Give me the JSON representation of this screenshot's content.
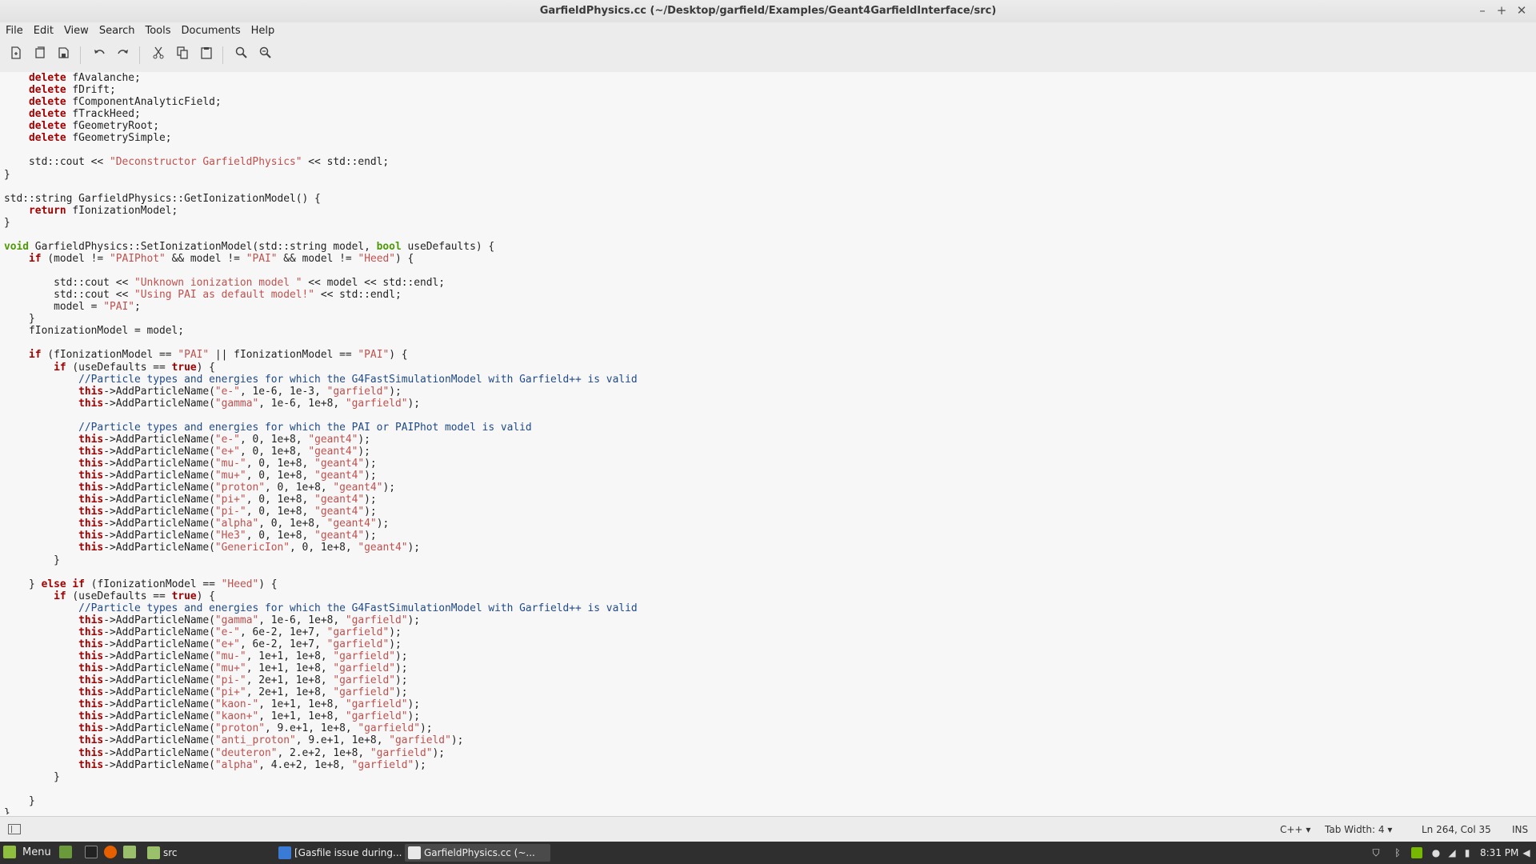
{
  "window": {
    "title": "GarfieldPhysics.cc (~/Desktop/garfield/Examples/Geant4GarfieldInterface/src)",
    "minimize_label": "–",
    "maximize_label": "+",
    "close_label": "✕"
  },
  "menu": [
    "File",
    "Edit",
    "View",
    "Search",
    "Tools",
    "Documents",
    "Help"
  ],
  "toolbar_icons": [
    "new-document-icon",
    "open-document-icon",
    "save-document-icon",
    "undo-icon",
    "redo-icon",
    "cut-icon",
    "copy-icon",
    "paste-icon",
    "find-icon",
    "find-replace-icon"
  ],
  "code_lines": [
    "    delete fAvalanche;",
    "    delete fDrift;",
    "    delete fComponentAnalyticField;",
    "    delete fTrackHeed;",
    "    delete fGeometryRoot;",
    "    delete fGeometrySimple;",
    "",
    "    std::cout << \"Deconstructor GarfieldPhysics\" << std::endl;",
    "}",
    "",
    "std::string GarfieldPhysics::GetIonizationModel() {",
    "    return fIonizationModel;",
    "}",
    "",
    "void GarfieldPhysics::SetIonizationModel(std::string model, bool useDefaults) {",
    "    if (model != \"PAIPhot\" && model != \"PAI\" && model != \"Heed\") {",
    "",
    "        std::cout << \"Unknown ionization model \" << model << std::endl;",
    "        std::cout << \"Using PAI as default model!\" << std::endl;",
    "        model = \"PAI\";",
    "    }",
    "    fIonizationModel = model;",
    "",
    "    if (fIonizationModel == \"PAI\" || fIonizationModel == \"PAI\") {",
    "        if (useDefaults == true) {",
    "            //Particle types and energies for which the G4FastSimulationModel with Garfield++ is valid",
    "            this->AddParticleName(\"e-\", 1e-6, 1e-3, \"garfield\");",
    "            this->AddParticleName(\"gamma\", 1e-6, 1e+8, \"garfield\");",
    "",
    "            //Particle types and energies for which the PAI or PAIPhot model is valid",
    "            this->AddParticleName(\"e-\", 0, 1e+8, \"geant4\");",
    "            this->AddParticleName(\"e+\", 0, 1e+8, \"geant4\");",
    "            this->AddParticleName(\"mu-\", 0, 1e+8, \"geant4\");",
    "            this->AddParticleName(\"mu+\", 0, 1e+8, \"geant4\");",
    "            this->AddParticleName(\"proton\", 0, 1e+8, \"geant4\");",
    "            this->AddParticleName(\"pi+\", 0, 1e+8, \"geant4\");",
    "            this->AddParticleName(\"pi-\", 0, 1e+8, \"geant4\");",
    "            this->AddParticleName(\"alpha\", 0, 1e+8, \"geant4\");",
    "            this->AddParticleName(\"He3\", 0, 1e+8, \"geant4\");",
    "            this->AddParticleName(\"GenericIon\", 0, 1e+8, \"geant4\");",
    "        }",
    "",
    "    } else if (fIonizationModel == \"Heed\") {",
    "        if (useDefaults == true) {",
    "            //Particle types and energies for which the G4FastSimulationModel with Garfield++ is valid",
    "            this->AddParticleName(\"gamma\", 1e-6, 1e+8, \"garfield\");",
    "            this->AddParticleName(\"e-\", 6e-2, 1e+7, \"garfield\");",
    "            this->AddParticleName(\"e+\", 6e-2, 1e+7, \"garfield\");",
    "            this->AddParticleName(\"mu-\", 1e+1, 1e+8, \"garfield\");",
    "            this->AddParticleName(\"mu+\", 1e+1, 1e+8, \"garfield\");",
    "            this->AddParticleName(\"pi-\", 2e+1, 1e+8, \"garfield\");",
    "            this->AddParticleName(\"pi+\", 2e+1, 1e+8, \"garfield\");",
    "            this->AddParticleName(\"kaon-\", 1e+1, 1e+8, \"garfield\");",
    "            this->AddParticleName(\"kaon+\", 1e+1, 1e+8, \"garfield\");",
    "            this->AddParticleName(\"proton\", 9.e+1, 1e+8, \"garfield\");",
    "            this->AddParticleName(\"anti_proton\", 9.e+1, 1e+8, \"garfield\");",
    "            this->AddParticleName(\"deuteron\", 2.e+2, 1e+8, \"garfield\");",
    "            this->AddParticleName(\"alpha\", 4.e+2, 1e+8, \"garfield\");",
    "        }",
    "",
    "    }",
    "}"
  ],
  "statusbar": {
    "language": "C++",
    "tab_width": "Tab Width: 4",
    "position": "Ln 264, Col 35",
    "mode": "INS"
  },
  "taskbar": {
    "menu_label": "Menu",
    "folder_label": "src",
    "windows": [
      {
        "label": "[Gasfile issue during..."
      },
      {
        "label": "GarfieldPhysics.cc (~..."
      }
    ],
    "clock": "8:31 PM"
  },
  "colors": {
    "keyword": "#a40000",
    "type": "#4e9a06",
    "string": "#c0504d",
    "comment": "#204a87",
    "editor_bg": "#f7f7f7",
    "taskbar_bg": "#2f2f2f"
  }
}
